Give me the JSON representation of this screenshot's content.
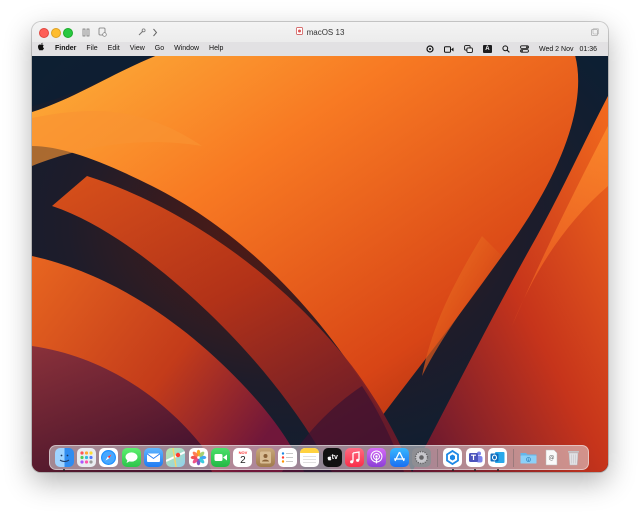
{
  "window": {
    "title": "macOS 13"
  },
  "menubar": {
    "app_name": "Finder",
    "menus": [
      "File",
      "Edit",
      "View",
      "Go",
      "Window",
      "Help"
    ],
    "keyboard_input_label": "A",
    "date": "Wed 2 Nov",
    "time": "01:36"
  },
  "dock": {
    "calendar_month": "NOV",
    "calendar_day": "2",
    "apps_label": "tv"
  },
  "colors": {
    "accent_orange": "#f27a2a",
    "wallpaper_dark": "#0d1f33",
    "traffic_red": "#fe5f57",
    "traffic_yellow": "#febc2e",
    "traffic_green": "#28c840"
  }
}
